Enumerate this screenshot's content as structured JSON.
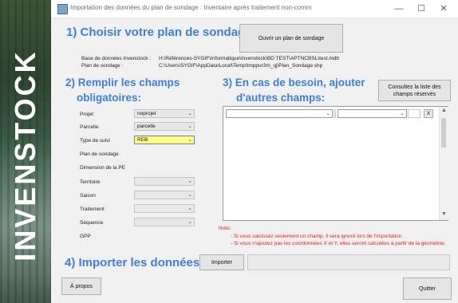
{
  "brand": {
    "vertical_text": "INVENSTOCK"
  },
  "window": {
    "title": "Importation des données du plan de sondage : Inventaire après traitement non-comm"
  },
  "section1": {
    "heading": "1) Choisir votre plan de sondage:",
    "button": "Ouvrir un plan de sondage",
    "db_label": "Base de données Invenstock :",
    "db_value": "H:\\Références-SYGIF\\Informatique\\Invenstock\\BD TEST\\APTNCBSL\\test.mdb",
    "plan_label": "Plan de sondage :",
    "plan_value": "C:\\Users\\SYGIF\\AppData\\Local\\Temp\\tmppur3m_qj\\Plan_Sondage.shp"
  },
  "section2": {
    "heading_line1": "2) Remplir les champs",
    "heading_line2": "obligatoires:",
    "fields": {
      "projet": {
        "label": "Projet",
        "value": "noprojet"
      },
      "parcelle": {
        "label": "Parcelle",
        "value": "parcelle"
      },
      "type_suivi": {
        "label": "Type de suivi",
        "value": "REB"
      },
      "plan": {
        "label": "Plan de sondage"
      },
      "dimension": {
        "label": "Dimension de la PE"
      },
      "territoire": {
        "label": "Territoire",
        "value": ""
      },
      "saison": {
        "label": "Saison",
        "value": ""
      },
      "traitement": {
        "label": "Traitement",
        "value": ""
      },
      "sequence": {
        "label": "Séquence",
        "value": ""
      },
      "gpp": {
        "label": "GPP"
      }
    }
  },
  "section3": {
    "heading_line1": "3) En cas de besoin, ajouter",
    "heading_line2": "d'autres champs:",
    "consult_button": "Consultez la liste des champs réservés",
    "remove_label": "X"
  },
  "notes": {
    "title": "Note:",
    "line1": "- Si vous saisissez seulement un champ, il sera ignoré lors de l'importation.",
    "line2": "- Si vous n'ajoutez pas les coordonnées X et Y, elles seront calculées à partir de la géométrie."
  },
  "section4": {
    "heading": "4) Importer les données :",
    "button": "Importer"
  },
  "footer": {
    "about_button": "À propos",
    "quit_button": "Quitter"
  },
  "colors": {
    "heading": "#3f7fd4",
    "note": "#e0202a",
    "highlight": "#ffff80"
  }
}
